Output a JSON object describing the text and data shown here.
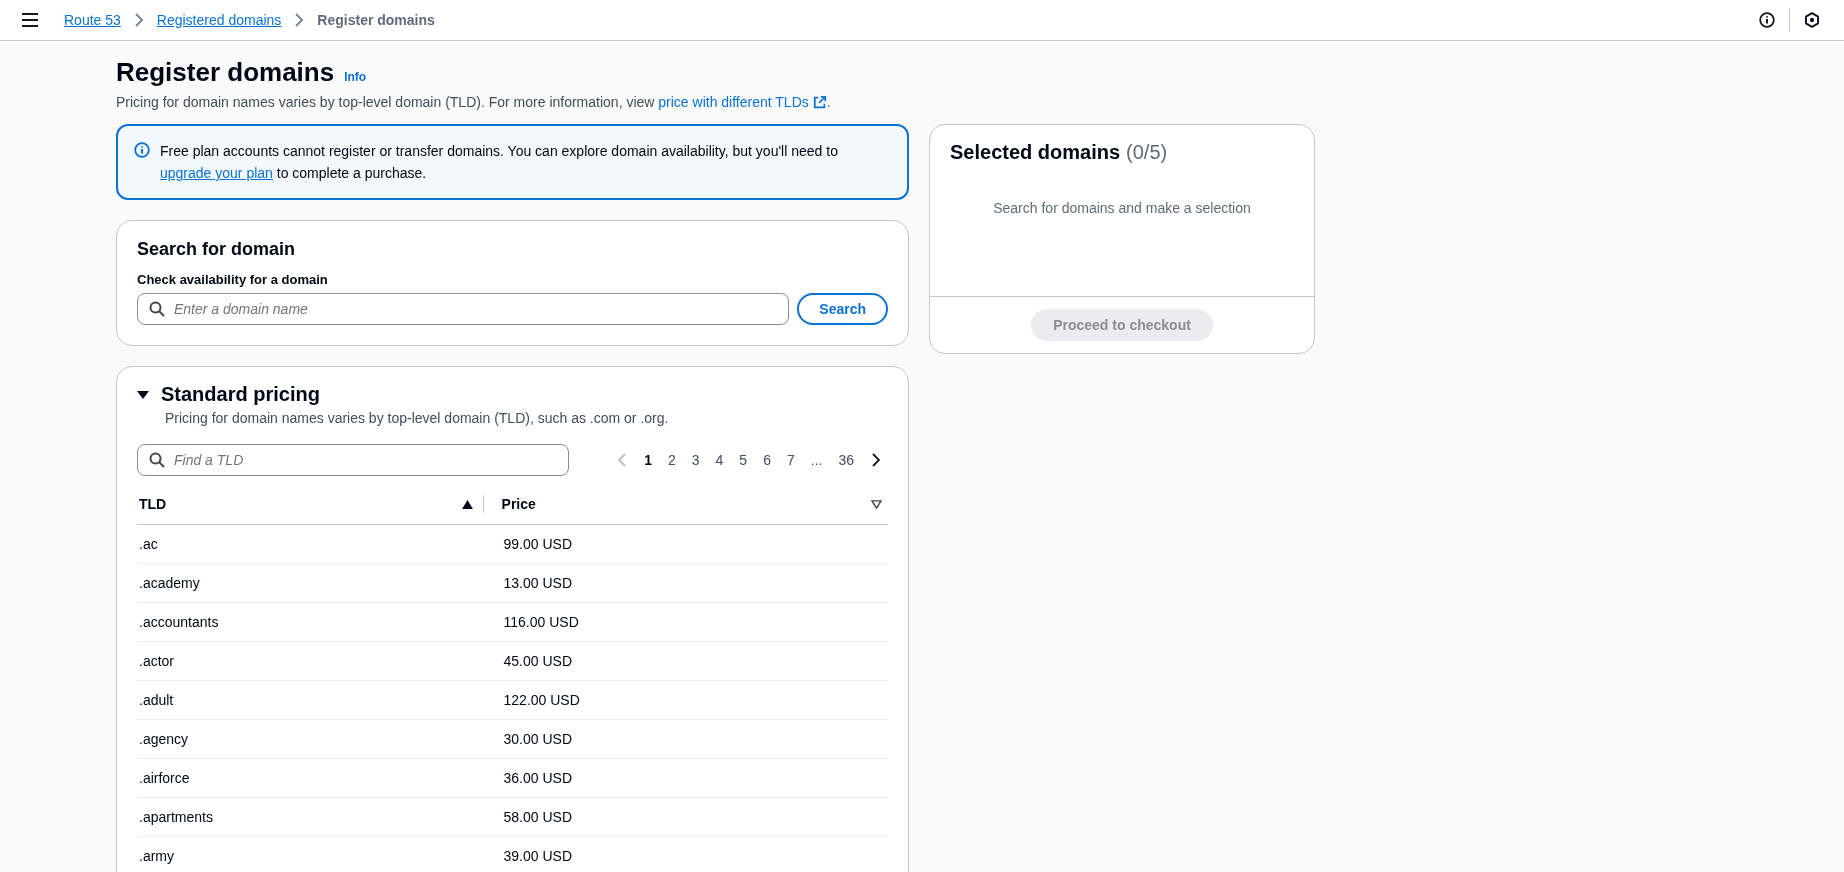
{
  "breadcrumbs": [
    {
      "label": "Route 53",
      "link": true
    },
    {
      "label": "Registered domains",
      "link": true
    },
    {
      "label": "Register domains",
      "link": false
    }
  ],
  "header": {
    "title": "Register domains",
    "info": "Info",
    "description": "Pricing for domain names varies by top-level domain (TLD). For more information, view ",
    "description_link": "price with different TLDs",
    "description_end": "."
  },
  "alert": {
    "text_before": "Free plan accounts cannot register or transfer domains. You can explore domain availability, but you'll need to ",
    "link": "upgrade your plan",
    "text_after": " to complete a purchase."
  },
  "search_card": {
    "title": "Search for domain",
    "label": "Check availability for a domain",
    "placeholder": "Enter a domain name",
    "button": "Search"
  },
  "pricing": {
    "title": "Standard pricing",
    "expanded": true,
    "description": "Pricing for domain names varies by top-level domain (TLD), such as .com or .org.",
    "filter_placeholder": "Find a TLD",
    "pagination": {
      "prev_disabled": true,
      "pages": [
        {
          "label": "1",
          "selected": true
        },
        {
          "label": "2",
          "selected": false
        },
        {
          "label": "3",
          "selected": false
        },
        {
          "label": "4",
          "selected": false
        },
        {
          "label": "5",
          "selected": false
        },
        {
          "label": "6",
          "selected": false
        },
        {
          "label": "7",
          "selected": false
        },
        {
          "label": "...",
          "selected": false
        },
        {
          "label": "36",
          "selected": false
        }
      ],
      "next_disabled": false
    },
    "columns": [
      {
        "label": "TLD",
        "sorted": true
      },
      {
        "label": "Price",
        "sorted": false
      }
    ],
    "rows": [
      {
        "tld": ".ac",
        "price": "99.00 USD"
      },
      {
        "tld": ".academy",
        "price": "13.00 USD"
      },
      {
        "tld": ".accountants",
        "price": "116.00 USD"
      },
      {
        "tld": ".actor",
        "price": "45.00 USD"
      },
      {
        "tld": ".adult",
        "price": "122.00 USD"
      },
      {
        "tld": ".agency",
        "price": "30.00 USD"
      },
      {
        "tld": ".airforce",
        "price": "36.00 USD"
      },
      {
        "tld": ".apartments",
        "price": "58.00 USD"
      },
      {
        "tld": ".army",
        "price": "39.00 USD"
      }
    ]
  },
  "selected_card": {
    "title": "Selected domains",
    "count": "(0/5)",
    "empty_text": "Search for domains and make a selection",
    "button": "Proceed to checkout",
    "button_disabled": true
  }
}
